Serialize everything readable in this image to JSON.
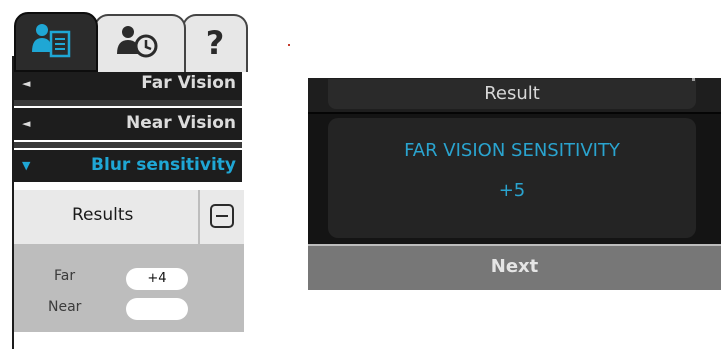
{
  "tabs": [
    {
      "icon": "patient-record-icon",
      "active": true
    },
    {
      "icon": "patient-history-icon",
      "active": false
    },
    {
      "icon": "help-icon",
      "glyph": "?",
      "active": false
    }
  ],
  "sections": [
    {
      "arrow": "◄",
      "label": "Far Vision"
    },
    {
      "arrow": "◄",
      "label": "Near Vision"
    },
    {
      "arrow": "▼",
      "label": "Blur sensitivity"
    }
  ],
  "results": {
    "title": "Results",
    "rows": [
      {
        "label": "Far",
        "value": "+4"
      },
      {
        "label": "Near",
        "value": ""
      }
    ]
  },
  "dialog": {
    "title": "Result",
    "message": "FAR VISION SENSITIVITY",
    "value": "+5",
    "next_label": "Next"
  },
  "colors": {
    "accent": "#1fa7d5",
    "panel_dark": "#1d1d1d",
    "result_blue": "#2aa4cf"
  }
}
